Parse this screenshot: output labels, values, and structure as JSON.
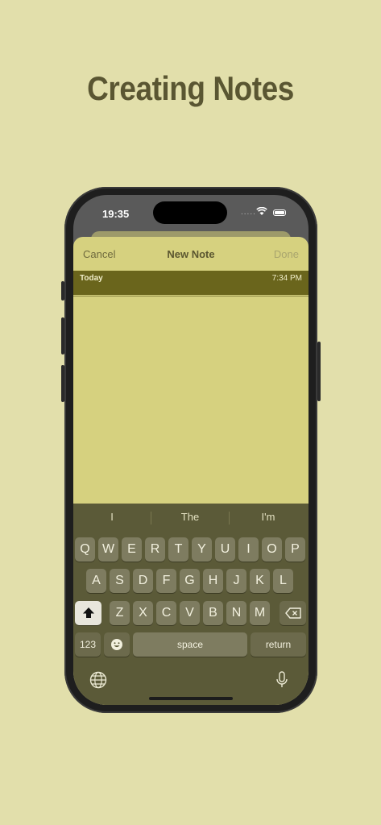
{
  "headline": "Creating Notes",
  "status_bar": {
    "time": "19:35",
    "signal": "....."
  },
  "nav": {
    "cancel": "Cancel",
    "title": "New Note",
    "done": "Done"
  },
  "note": {
    "date_label": "Today",
    "time_label": "7:34 PM"
  },
  "keyboard": {
    "suggestions": [
      "I",
      "The",
      "I'm"
    ],
    "row1": [
      "Q",
      "W",
      "E",
      "R",
      "T",
      "Y",
      "U",
      "I",
      "O",
      "P"
    ],
    "row2": [
      "A",
      "S",
      "D",
      "F",
      "G",
      "H",
      "J",
      "K",
      "L"
    ],
    "row3": [
      "Z",
      "X",
      "C",
      "V",
      "B",
      "N",
      "M"
    ],
    "numbers_key": "123",
    "space_key": "space",
    "return_key": "return",
    "icons": {
      "shift": "shift-arrow-icon",
      "backspace": "backspace-icon",
      "emoji": "emoji-icon",
      "globe": "globe-icon",
      "mic": "microphone-icon"
    }
  },
  "colors": {
    "background": "#e2dfab",
    "headline": "#5a5632",
    "note_paper": "#d6d17f",
    "date_band": "#6a651c",
    "keyboard": "#5b5a38"
  }
}
